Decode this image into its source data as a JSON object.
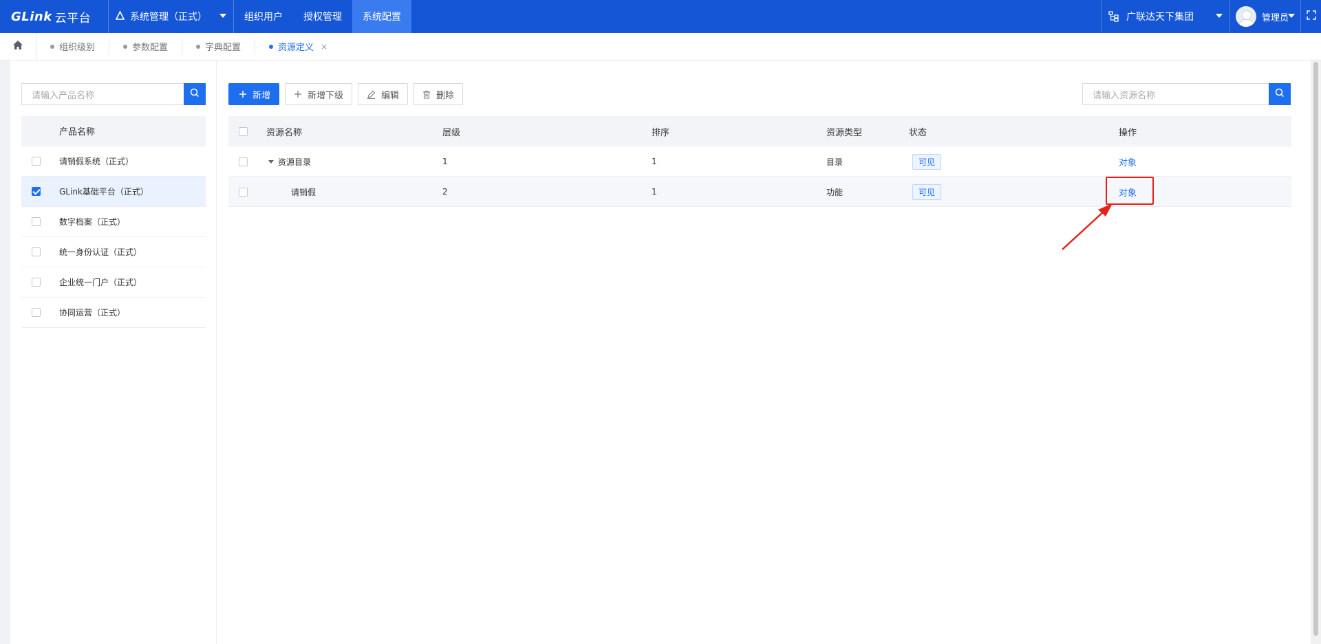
{
  "topbar": {
    "logo_latin": "GLink",
    "logo_cn": "云平台",
    "system_select": "系统管理（正式）",
    "nav": [
      "组织用户",
      "授权管理",
      "系统配置"
    ],
    "active_nav": 2,
    "org": "广联达天下集团",
    "user": "管理员"
  },
  "tabs": {
    "items": [
      "组织级别",
      "参数配置",
      "字典配置",
      "资源定义"
    ],
    "active": 3,
    "close_glyph": "×"
  },
  "left": {
    "search_placeholder": "请输入产品名称",
    "header": "产品名称",
    "products": [
      {
        "name": "请销假系统（正式）",
        "checked": false
      },
      {
        "name": "GLink基础平台（正式）",
        "checked": true
      },
      {
        "name": "数字档案（正式）",
        "checked": false
      },
      {
        "name": "统一身份认证（正式）",
        "checked": false
      },
      {
        "name": "企业统一门户（正式）",
        "checked": false
      },
      {
        "name": "协同运营（正式）",
        "checked": false
      }
    ]
  },
  "toolbar": {
    "add": "新增",
    "add_child": "新增下级",
    "edit": "编辑",
    "delete": "删除",
    "search_placeholder": "请输入资源名称"
  },
  "grid": {
    "columns": [
      "资源名称",
      "层级",
      "排序",
      "资源类型",
      "状态",
      "操作"
    ],
    "rows": [
      {
        "name": "资源目录",
        "level": "1",
        "order": "1",
        "type": "目录",
        "status": "可见",
        "action": "对象"
      },
      {
        "name": "请销假",
        "level": "2",
        "order": "1",
        "type": "功能",
        "status": "可见",
        "action": "对象"
      }
    ]
  },
  "colors": {
    "primary": "#1e6ff0",
    "topbar": "#1456d6",
    "annotation": "#e62117"
  }
}
